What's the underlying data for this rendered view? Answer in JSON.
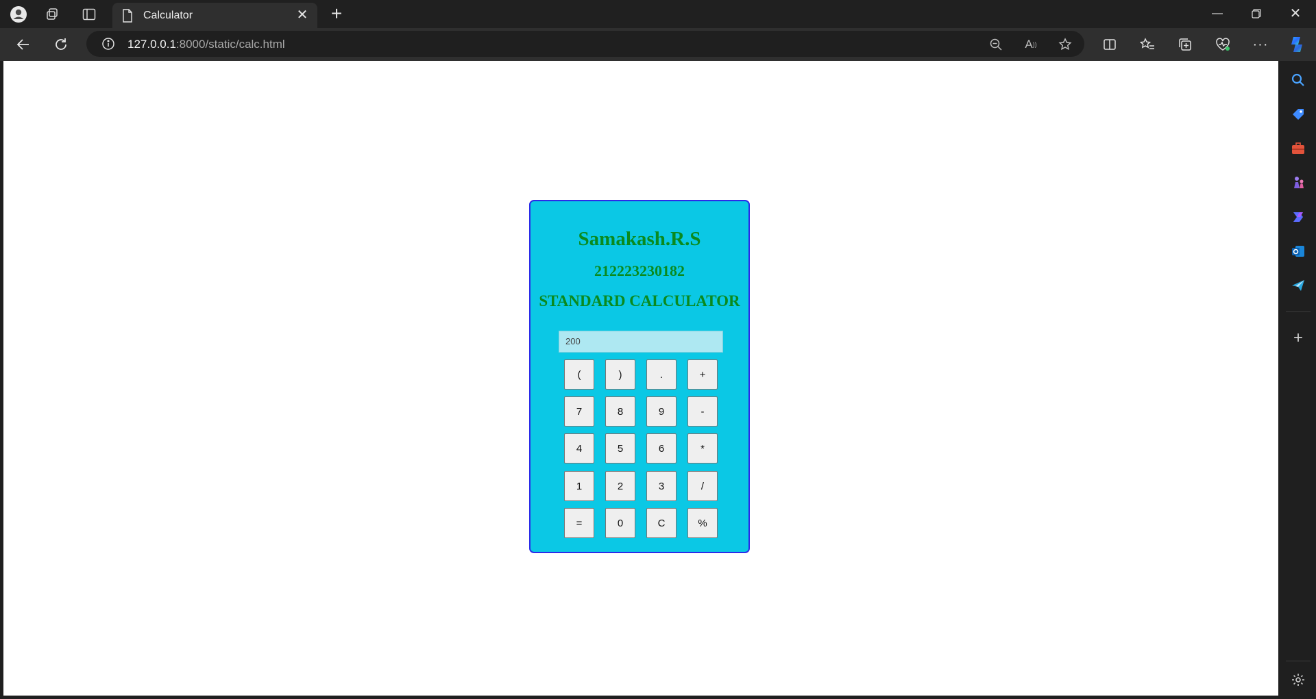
{
  "browser": {
    "tab_title": "Calculator",
    "url_host": "127.0.0.1",
    "url_rest": ":8000/static/calc.html"
  },
  "calculator": {
    "name": "Samakash.R.S",
    "reg_no": "212223230182",
    "title": "STANDARD CALCULATOR",
    "display_value": "200",
    "keys": [
      [
        "(",
        ")",
        ".",
        "+"
      ],
      [
        "7",
        "8",
        "9",
        "-"
      ],
      [
        "4",
        "5",
        "6",
        "*"
      ],
      [
        "1",
        "2",
        "3",
        "/"
      ],
      [
        "=",
        "0",
        "C",
        "%"
      ]
    ]
  },
  "colors": {
    "calc_bg": "#0bc8e5",
    "calc_border": "#2b2be8",
    "heading": "#0a8a1e",
    "display_bg": "#aee8f2"
  }
}
